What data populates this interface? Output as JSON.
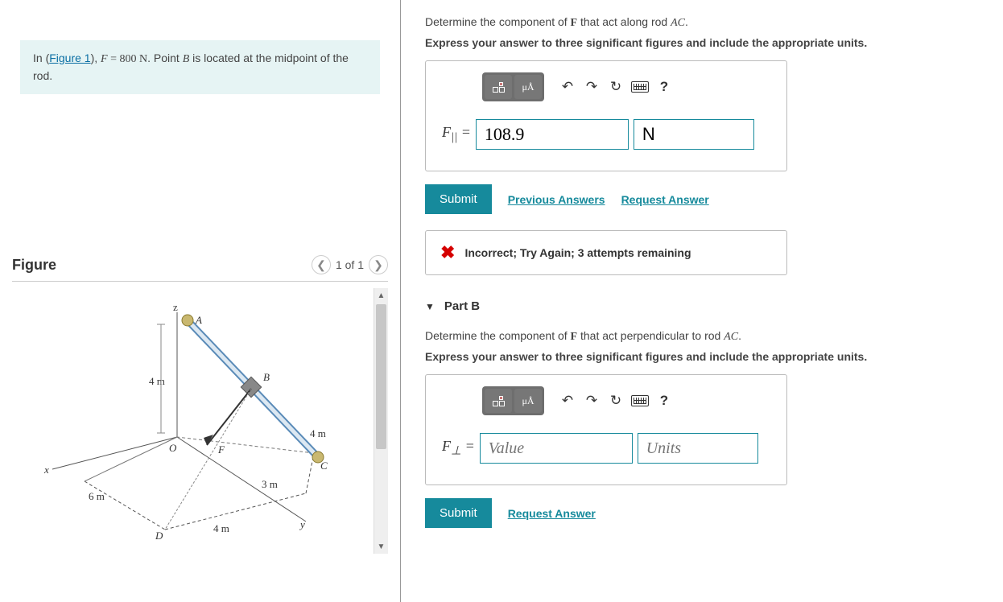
{
  "problem": {
    "prefix": "In (",
    "figure_link": "Figure 1",
    "text_1": "), ",
    "force_var": "F",
    "force_eq": " = 800 N",
    "text_2": ". Point ",
    "point_B": "B",
    "text_3": " is located at the midpoint of the rod."
  },
  "figure_panel": {
    "title": "Figure",
    "page_indicator": "1 of 1"
  },
  "figure_labels": {
    "z": "z",
    "A": "A",
    "four_m_1": "4 m",
    "B": "B",
    "O": "O",
    "F": "F",
    "four_m_2": "4 m",
    "C": "C",
    "three_m": "3 m",
    "x": "x",
    "six_m": "6 m",
    "D": "D",
    "four_m_3": "4 m",
    "y": "y"
  },
  "partA": {
    "prompt_1a": "Determine the component of ",
    "prompt_1b": "F",
    "prompt_1c": " that act along rod ",
    "prompt_1d": "AC",
    "prompt_1e": ".",
    "prompt_bold": "Express your answer to three significant figures and include the appropriate units.",
    "special_btn": "μÅ",
    "label_html": "F<sub>||</sub> =",
    "label_text": "F|| =",
    "value": "108.9",
    "units": "N",
    "submit": "Submit",
    "prev_answers": "Previous Answers",
    "request_answer": "Request Answer",
    "feedback": "Incorrect; Try Again; 3 attempts remaining",
    "help_q": "?"
  },
  "partB": {
    "header": "Part B",
    "prompt_1a": "Determine the component of ",
    "prompt_1b": "F",
    "prompt_1c": " that act perpendicular to rod ",
    "prompt_1d": "AC",
    "prompt_1e": ".",
    "prompt_bold": "Express your answer to three significant figures and include the appropriate units.",
    "special_btn": "μÅ",
    "label_text": "F⊥ =",
    "value_placeholder": "Value",
    "units_placeholder": "Units",
    "submit": "Submit",
    "request_answer": "Request Answer",
    "help_q": "?"
  }
}
